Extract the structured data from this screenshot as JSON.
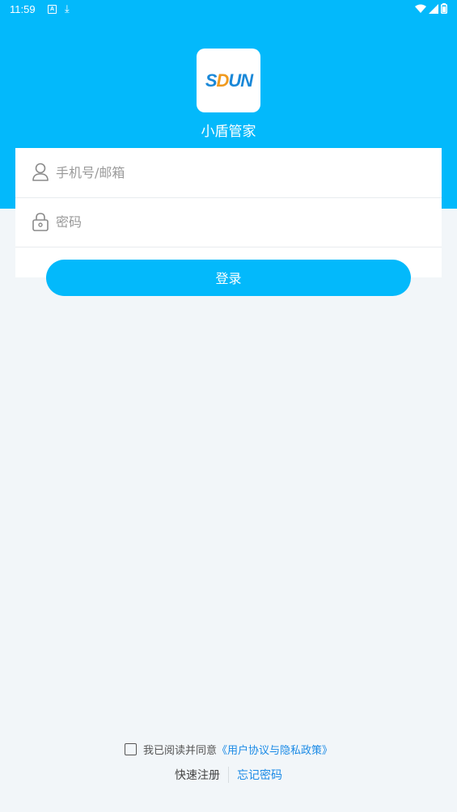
{
  "status_bar": {
    "time": "11:59"
  },
  "app": {
    "name": "小盾管家",
    "logo_text": "SDUN"
  },
  "form": {
    "account_placeholder": "手机号/邮箱",
    "password_placeholder": "密码",
    "login_label": "登录"
  },
  "agreement": {
    "prefix": "我已阅读并同意",
    "policy_link": "《用户协议与隐私政策》",
    "checked": false
  },
  "links": {
    "register": "快速注册",
    "forgot_password": "忘记密码"
  },
  "colors": {
    "primary": "#03b9fb",
    "link": "#1a8ae6",
    "background": "#f2f6f9"
  },
  "icons": [
    "a-notification-icon",
    "download-icon",
    "wifi-icon",
    "signal-icon",
    "battery-icon",
    "user-icon",
    "lock-icon"
  ]
}
